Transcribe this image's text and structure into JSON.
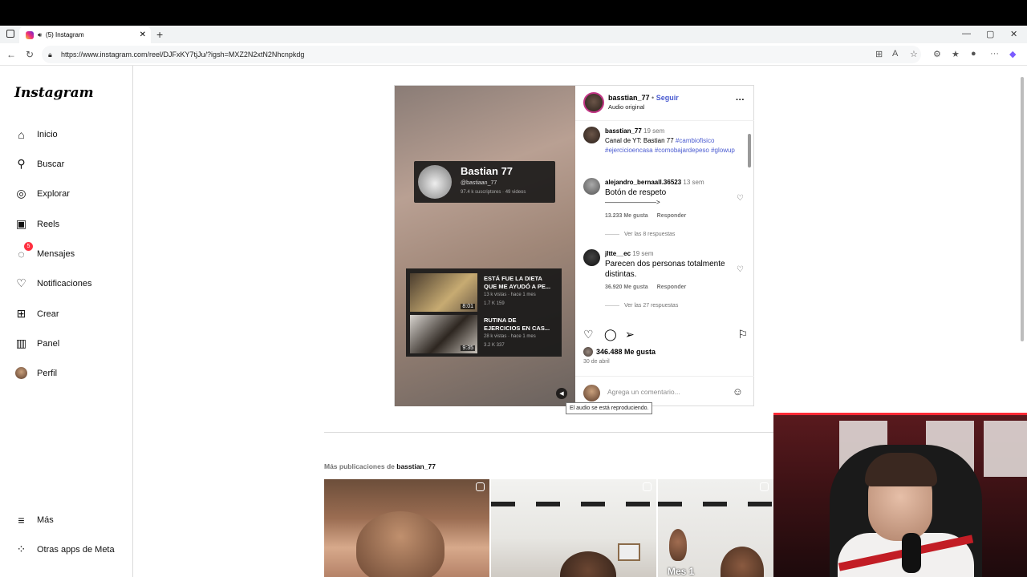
{
  "browser": {
    "tab_title": "(5) Instagram",
    "tab_close": "✕",
    "new_tab": "+",
    "url": "https://www.instagram.com/reel/DJFxKY7tjJu/?igsh=MXZ2N2xtN2Nhcnpkdg",
    "win_min": "—",
    "win_max": "▢",
    "win_close": "✕"
  },
  "sidebar": {
    "logo": "Instagram",
    "items": [
      {
        "label": "Inicio",
        "icon": "home-icon"
      },
      {
        "label": "Buscar",
        "icon": "search-icon"
      },
      {
        "label": "Explorar",
        "icon": "compass-icon"
      },
      {
        "label": "Reels",
        "icon": "reels-icon"
      },
      {
        "label": "Mensajes",
        "icon": "messenger-icon",
        "badge": "5"
      },
      {
        "label": "Notificaciones",
        "icon": "heart-icon"
      },
      {
        "label": "Crear",
        "icon": "plus-square-icon"
      },
      {
        "label": "Panel",
        "icon": "chart-icon"
      },
      {
        "label": "Perfil",
        "icon": "avatar"
      }
    ],
    "more": "Más",
    "meta_apps": "Otras apps de Meta"
  },
  "video": {
    "yt_channel_name": "Bastian 77",
    "yt_handle": "@bastiaan_77",
    "yt_stats": "97.4 k suscriptores · 49 videos",
    "yt_videos": [
      {
        "title": "ESTÁ FUE LA DIETA QUE ME AYUDÓ A PE...",
        "meta": "13 k vistas · hace 1 mes",
        "likes": "1.7 K   159",
        "duration": "8:01"
      },
      {
        "title": "RUTINA DE EJERCICIOS EN CAS...",
        "meta": "28 k vistas · hace 1 mes",
        "likes": "3.2 K   337",
        "duration": "9:35"
      }
    ],
    "audio_tooltip": "El audio se está reproduciendo."
  },
  "post": {
    "username": "basstian_77",
    "follow": "Seguir",
    "separator": "•",
    "audio": "Audio original",
    "more": "···",
    "caption": {
      "user": "basstian_77",
      "time": "19 sem",
      "text": "Canal de YT: Bastian 77",
      "tags": "#cambiofisico #ejercicioencasa #comobajardepeso #glowup"
    },
    "comments": [
      {
        "user": "alejandro_bernaall.36523",
        "time": "13 sem",
        "text": "Botón de respeto",
        "arrow": "————————>",
        "likes": "13.233 Me gusta",
        "reply": "Responder",
        "replies": "Ver las 8 respuestas"
      },
      {
        "user": "jltte__ec",
        "time": "19 sem",
        "text": "Parecen dos personas totalmente distintas.",
        "likes": "36.920 Me gusta",
        "reply": "Responder",
        "replies": "Ver las 27 respuestas"
      }
    ],
    "likes_count": "346.488 Me gusta",
    "date": "30 de abril",
    "comment_placeholder": "Agrega un comentario..."
  },
  "more_posts": {
    "prefix": "Más publicaciones de",
    "user": "basstian_77",
    "thumb3_caption": "Mes 1"
  },
  "colors": {
    "link_blue": "#4a5bd0",
    "badge_red": "#ff3040"
  }
}
